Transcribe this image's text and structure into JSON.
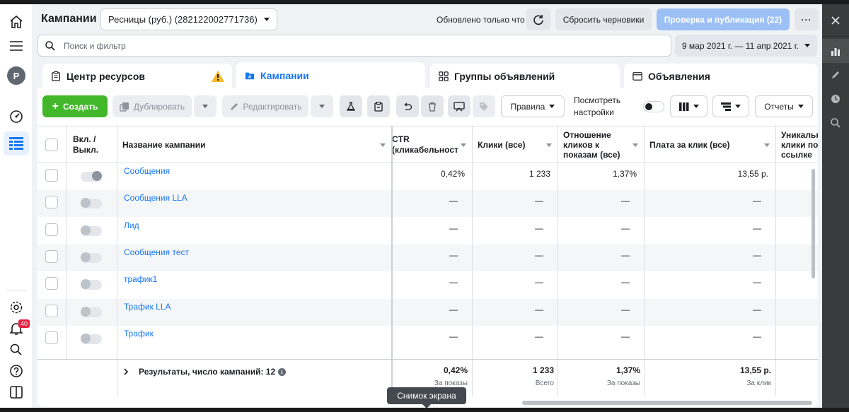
{
  "header": {
    "title": "Кампании",
    "account": "Ресницы (руб.) (282122002771736)",
    "updated": "Обновлено только что",
    "reset_label": "Сбросить черновики",
    "publish_label": "Проверка и публикация (22)",
    "more_label": "···"
  },
  "search": {
    "placeholder": "Поиск и фильтр",
    "date_range": "9 мар 2021 г. — 11 апр 2021 г."
  },
  "tabs": [
    {
      "label": "Центр ресурсов"
    },
    {
      "label": "Кампании"
    },
    {
      "label": "Группы объявлений"
    },
    {
      "label": "Объявления"
    }
  ],
  "toolbar": {
    "create": "Создать",
    "duplicate": "Дублировать",
    "edit": "Редактировать",
    "rules": "Правила",
    "view_settings_1": "Посмотреть",
    "view_settings_2": "настройки",
    "reports": "Отчеты"
  },
  "table": {
    "headers": {
      "onoff": "Вкл. / Выкл.",
      "name": "Название кампании",
      "ctr": "CTR (кликабельност",
      "clicks": "Клики (все)",
      "ratio": "Отношение кликов к показам (все)",
      "cpc": "Плата за клик (все)",
      "unique": "Уникальн клики по ссылке"
    },
    "rows": [
      {
        "name": "Сообщения",
        "ctr": "0,42%",
        "clicks": "1 233",
        "ratio": "1,37%",
        "cpc": "13,55 р.",
        "on": true
      },
      {
        "name": "Сообщения LLA",
        "ctr": "—",
        "clicks": "—",
        "ratio": "—",
        "cpc": "—",
        "on": false
      },
      {
        "name": "Лид",
        "ctr": "—",
        "clicks": "—",
        "ratio": "—",
        "cpc": "—",
        "on": false
      },
      {
        "name": "Сообщения тест",
        "ctr": "—",
        "clicks": "—",
        "ratio": "—",
        "cpc": "—",
        "on": false
      },
      {
        "name": "трафик1",
        "ctr": "—",
        "clicks": "—",
        "ratio": "—",
        "cpc": "—",
        "on": false
      },
      {
        "name": "Трафик LLA",
        "ctr": "—",
        "clicks": "—",
        "ratio": "—",
        "cpc": "—",
        "on": false
      },
      {
        "name": "Трафик",
        "ctr": "—",
        "clicks": "—",
        "ratio": "—",
        "cpc": "—",
        "on": false
      }
    ],
    "summary": {
      "label": "Результаты, число кампаний: 12",
      "ctr": "0,42%",
      "ctr_sub": "За показы",
      "clicks": "1 233",
      "clicks_sub": "Всего",
      "ratio": "1,37%",
      "ratio_sub": "За показы",
      "cpc": "13,55 р.",
      "cpc_sub": "За клик"
    }
  },
  "left_rail": {
    "avatar": "P",
    "notifications": "40"
  },
  "tooltip": "Снимок экрана"
}
